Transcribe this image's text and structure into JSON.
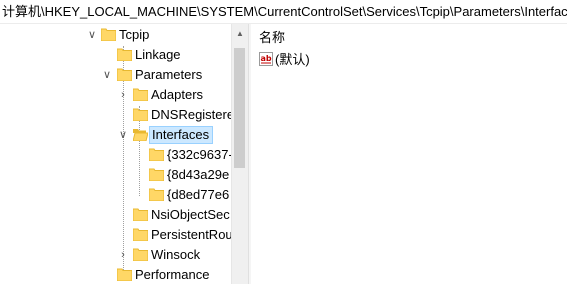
{
  "address_bar": {
    "path": "计算机\\HKEY_LOCAL_MACHINE\\SYSTEM\\CurrentControlSet\\Services\\Tcpip\\Parameters\\Interfaces"
  },
  "tree": {
    "nodes": [
      {
        "label": "Tcpip",
        "expanded": true
      },
      {
        "label": "Linkage"
      },
      {
        "label": "Parameters",
        "expanded": true
      },
      {
        "label": "Adapters",
        "expanded": false
      },
      {
        "label": "DNSRegistere"
      },
      {
        "label": "Interfaces",
        "expanded": true,
        "selected": true
      },
      {
        "label": "{332c9637-"
      },
      {
        "label": "{8d43a29e"
      },
      {
        "label": "{d8ed77e6"
      },
      {
        "label": "NsiObjectSec"
      },
      {
        "label": "PersistentRou"
      },
      {
        "label": "Winsock",
        "expanded": false
      },
      {
        "label": "Performance"
      }
    ]
  },
  "values_pane": {
    "column_name": "名称",
    "rows": [
      {
        "icon": "string-value-icon",
        "icon_text": "ab",
        "name": "(默认)"
      }
    ]
  },
  "colors": {
    "selection_fill": "#cce8ff",
    "selection_border": "#99d1ff",
    "folder_fill": "#ffd766",
    "folder_tab": "#e8b830"
  }
}
